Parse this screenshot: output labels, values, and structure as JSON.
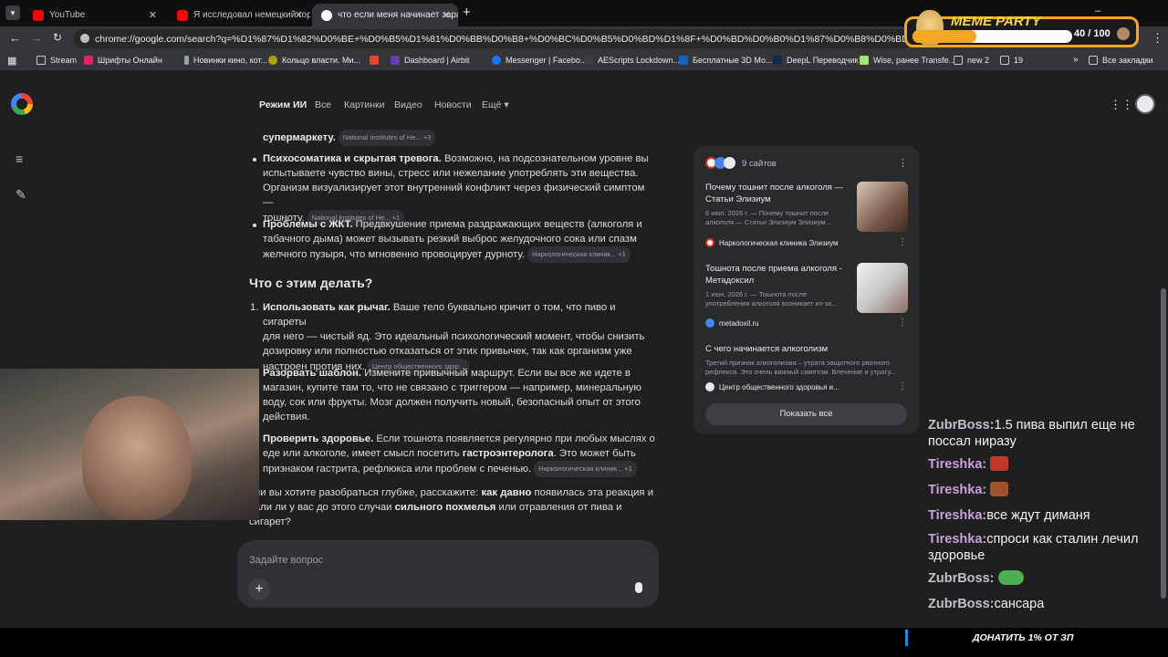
{
  "browser": {
    "tabs": [
      {
        "title": "YouTube",
        "color": "#ff0000"
      },
      {
        "title": "Я исследовал немецкий город",
        "color": "#ff0000"
      },
      {
        "title": "что если меня начинает зараз",
        "color": "#4285f4"
      }
    ],
    "new_tab": "+",
    "url": "chrome://google.com/search?q=%D1%87%D1%82%D0%BE+%D0%B5%D1%81%D0%BB%D0%B8+%D0%BC%D0%B5%D0%BD%D1%8F+%D0%BD%D0%B0%D1%87%D0%B8%D0%BD%D0%B0%D0%B5%D1%82+%D0",
    "bookmarks": [
      "Stream",
      "Шрифты Онлайн",
      "Новинки кино, кот...",
      "Кольцо власти. Ми...",
      "Dashboard | Airbit",
      "Messenger | Facebo...",
      "AEScripts Lockdown...",
      "Бесплатные 3D Мо...",
      "DeepL Переводчик",
      "Wise, ранее Transfe...",
      "new 2",
      "19",
      "Все закладки"
    ]
  },
  "overlay": {
    "meme_party": "MEME PARTY",
    "counter": "40 / 100",
    "donate": "ДОНАТИТЬ 1% ОТ ЗП"
  },
  "google": {
    "logo": "G",
    "nav": [
      "Режим ИИ",
      "Все",
      "Картинки",
      "Видео",
      "Новости",
      "Ещё"
    ],
    "p0": "супермаркету.",
    "chip0": "National Institutes of He...",
    "chip0_more": "+3",
    "b1_title": "Психосоматика и скрытая тревога.",
    "b1_l1": "Возможно, на подсознательном уровне вы",
    "b1_l2": "испытываете чувство вины, стресс или нежелание употреблять эти вещества.",
    "b1_l3": "Организм визуализирует этот внутренний конфликт через физический симптом —",
    "b1_l4": "тошноту.",
    "chip1": "National Institutes of He...",
    "chip1_more": "+1",
    "b2_title": "Проблемы с ЖКТ.",
    "b2_l1": "Предвкушение приема раздражающих веществ (алкоголя и",
    "b2_l2": "табачного дыма) может вызывать резкий выброс желудочного сока или спазм",
    "b2_l3": "желчного пузыря, что мгновенно провоцирует дурноту.",
    "chip2": "Наркологическая клиник...",
    "chip2_more": "+1",
    "heading": "Что с этим делать?",
    "n1_num": "1.",
    "n1_title": "Использовать как рычаг.",
    "n1_l1": "Ваше тело буквально кричит о том, что пиво и сигареты",
    "n1_l2": "для него — чистый яд. Это идеальный психологический момент, чтобы снизить",
    "n1_l3": "дозировку или полностью отказаться от этих привычек, так как организм уже",
    "n1_l4": "настроен против них.",
    "chip3": "Центр общественного здор...",
    "n2_title": "Разорвать шаблон.",
    "n2_l1": "Измените привычный маршрут. Если вы все же идете в",
    "n2_l2": "магазин, купите там то, что не связано с триггером — например, минеральную",
    "n2_l3": "воду, сок или фрукты. Мозг должен получить новый, безопасный опыт от этого",
    "n2_l4": "действия.",
    "n3_title": "Проверить здоровье.",
    "n3_l1": "Если тошнота появляется регулярно при любых мыслях о",
    "n3_l2a": "еде или алкоголе, имеет смысл посетить",
    "n3_l2b": "гастроэнтеролога",
    "n3_l2c": ". Это может быть",
    "n3_l3": "признаком гастрита, рефлюкса или проблем с печенью.",
    "chip4": "Наркологическая клиник...",
    "chip4_more": "+1",
    "q_l1a": "сли вы хотите разобраться глубже, расскажите:",
    "q_l1b": "как давно",
    "q_l1c": "появилась эта реакция и",
    "q_l2a": "вали ли у вас до этого случаи",
    "q_l2b": "сильного похмелья",
    "q_l2c": "или отравления от пива и",
    "q_l3": "сигарет?",
    "ask_placeholder": "Задайте вопрос",
    "sources": {
      "count": "9 сайтов",
      "items": [
        {
          "title1": "Почему тошнит после алкоголя —",
          "title2": "Статьи Элизиум",
          "sub1": "6 июл. 2026 г. — Почему тошнит после",
          "sub2": "алкоголя — Статьи Элизиум Элизиум...",
          "site": "Наркологическая клиника Элизиум"
        },
        {
          "title1": "Тошнота после приема алкоголя -",
          "title2": "Метадоксил",
          "sub1": "1 июн. 2026 г. — Тошнота после",
          "sub2": "употребления алкоголя возникает из-за...",
          "site": "metadoxil.ru"
        },
        {
          "title1": "С чего начинается алкоголизм",
          "title2": "",
          "sub1": "Третий признак алкоголизма – утрата защитного рвотного",
          "sub2": "рефлекса. Это очень важный симптом. Влечение и утрату...",
          "site": "Центр общественного здоровья и..."
        }
      ],
      "show_all": "Показать все"
    }
  },
  "chat": [
    {
      "user": "ZubrBoss:",
      "msg": "1.5 пива выпил еще не поссал ниразу"
    },
    {
      "user": "Tireshka:",
      "msg": ""
    },
    {
      "user": "Tireshka:",
      "msg": ""
    },
    {
      "user": "Tireshka:",
      "msg": "все ждут диманя"
    },
    {
      "user": "Tireshka:",
      "msg": "спроси как сталин лечил здоровье"
    },
    {
      "user": "ZubrBoss:",
      "msg": ""
    },
    {
      "user": "ZubrBoss:",
      "msg": "сансара"
    }
  ]
}
